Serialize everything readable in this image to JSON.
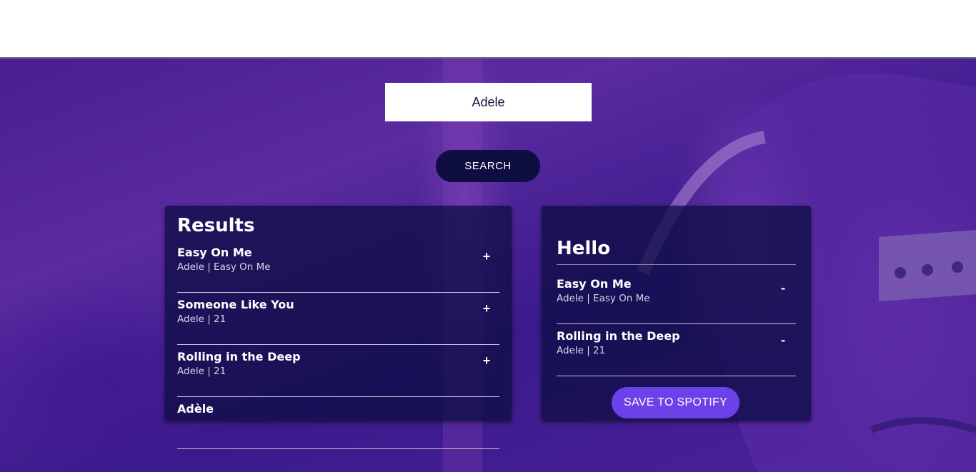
{
  "search": {
    "value": "Adele",
    "button_label": "SEARCH"
  },
  "results": {
    "title": "Results",
    "tracks": [
      {
        "title": "Easy On Me",
        "subtitle": "Adele | Easy On Me",
        "action": "+"
      },
      {
        "title": "Someone Like You",
        "subtitle": "Adele | 21",
        "action": "+"
      },
      {
        "title": "Rolling in the Deep",
        "subtitle": "Adele | 21",
        "action": "+"
      },
      {
        "title": "Adèle",
        "subtitle": "",
        "action": ""
      }
    ]
  },
  "playlist": {
    "name": "Hello",
    "tracks": [
      {
        "title": "Easy On Me",
        "subtitle": "Adele | Easy On Me",
        "action": "-"
      },
      {
        "title": "Rolling in the Deep",
        "subtitle": "Adele | 21",
        "action": "-"
      }
    ],
    "save_label": "SAVE TO SPOTIFY"
  },
  "colors": {
    "background": "#4a1d93",
    "panel": "#100e46",
    "search_button": "#0e0e40",
    "save_button": "#6c41e8"
  }
}
